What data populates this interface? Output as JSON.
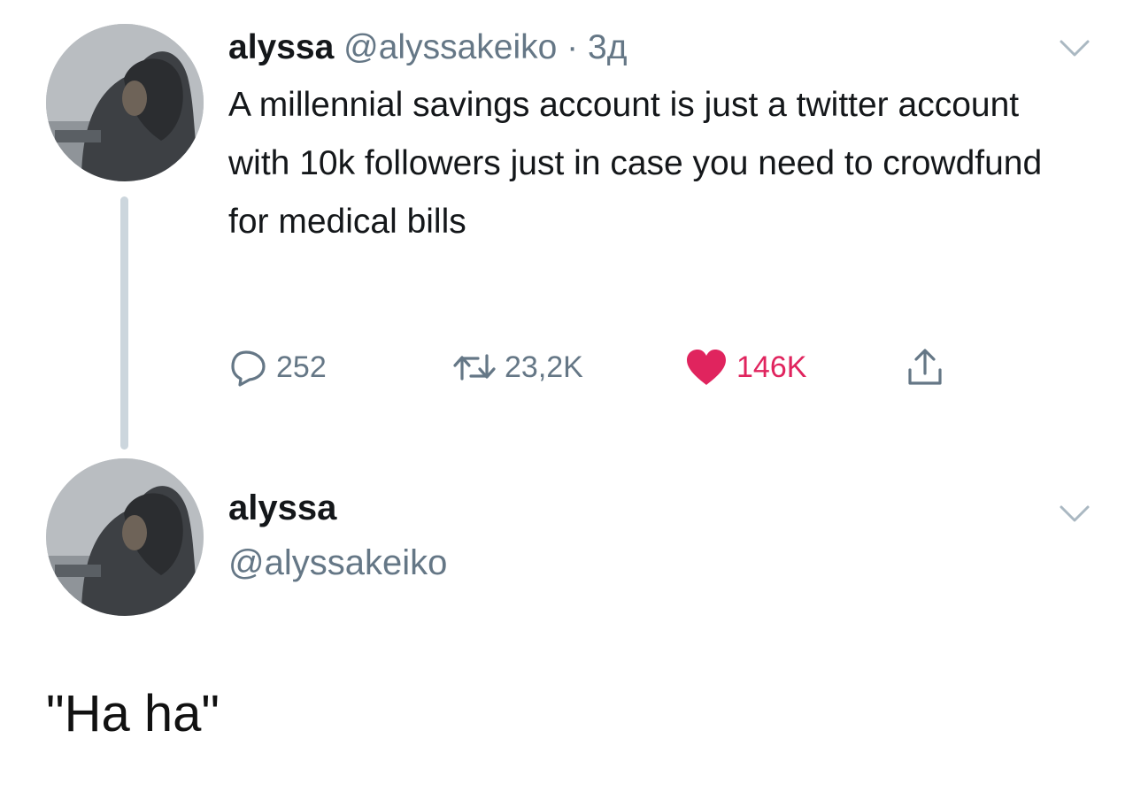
{
  "tweet": {
    "author": {
      "display_name": "alyssa",
      "handle": "@alyssakeiko"
    },
    "separator": "·",
    "time": "3д",
    "text": "A millennial savings account is just a twitter account with 10k followers just in case you need to crowdfund for medical bills",
    "actions": {
      "reply": {
        "icon": "reply-icon",
        "count": "252"
      },
      "retweet": {
        "icon": "retweet-icon",
        "count": "23,2K"
      },
      "like": {
        "icon": "heart-icon",
        "count": "146K",
        "active": true,
        "color": "#e0245e"
      },
      "share": {
        "icon": "share-icon"
      }
    }
  },
  "reply_author": {
    "display_name": "alyssa",
    "handle": "@alyssakeiko"
  },
  "caption": "\"Ha ha\"",
  "colors": {
    "text_primary": "#14171a",
    "text_secondary": "#657786",
    "thread_line": "#ccd6dd",
    "like_active": "#e0245e"
  }
}
